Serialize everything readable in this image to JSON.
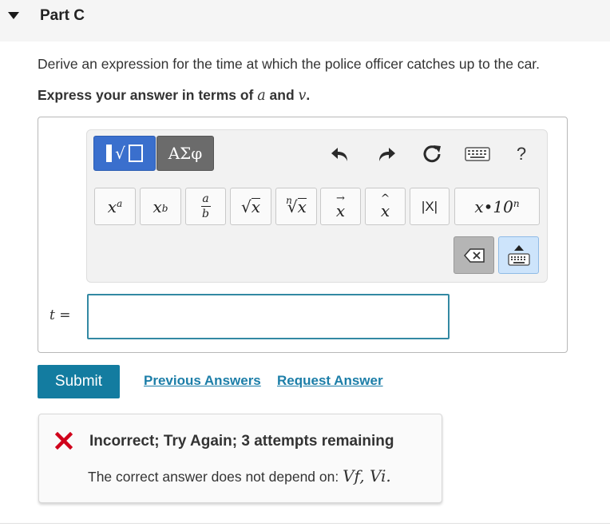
{
  "part": {
    "title": "Part C"
  },
  "question": {
    "prompt": "Derive an expression for the time at which the police officer catches up to the car.",
    "instruction_prefix": "Express your answer in terms of ",
    "var_a": "a",
    "instruction_and": " and ",
    "var_v": "v",
    "instruction_suffix": "."
  },
  "toolbar": {
    "templates_icon": "templates-icon",
    "greek_label": "ΑΣφ",
    "undo_icon": "undo-icon",
    "redo_icon": "redo-icon",
    "reset_icon": "reset-icon",
    "keyboard_shortcuts_icon": "keyboard-icon",
    "help_label": "?",
    "buttons": {
      "superscript": {
        "base": "x",
        "exp": "a"
      },
      "subscript": {
        "base": "x",
        "sub": "b"
      },
      "fraction": {
        "num": "a",
        "den": "b"
      },
      "sqrt": {
        "radical": "√",
        "arg": "x"
      },
      "nthroot": {
        "index": "n",
        "radical": "√",
        "arg": "x"
      },
      "vector": {
        "arrow": "→",
        "arg": "x"
      },
      "unitvector": {
        "hat": "^",
        "arg": "x"
      },
      "abs": {
        "label": "|X|"
      },
      "sci": {
        "label": "x•10",
        "exp": "n"
      }
    },
    "delete_icon": "backspace-icon",
    "virtual_keyboard_icon": "keyboard-toggle-icon"
  },
  "answer": {
    "variable": "t",
    "equals": " =",
    "value": ""
  },
  "actions": {
    "submit_label": "Submit",
    "previous_answers_label": "Previous Answers",
    "request_answer_label": "Request Answer"
  },
  "feedback": {
    "status_icon": "x-icon",
    "title": "Incorrect; Try Again; 3 attempts remaining",
    "detail_prefix": "The correct answer does not depend on: ",
    "detail_vars": "Vf, Vi.",
    "error_color": "#d0021b"
  },
  "colors": {
    "accent": "#137ca0",
    "link": "#1c7ea8",
    "templates_button": "#3a6fcd",
    "greek_button": "#6b6b6b",
    "input_border": "#3389a3"
  }
}
